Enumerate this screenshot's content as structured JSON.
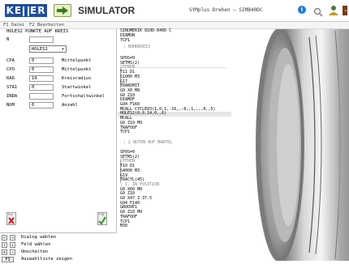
{
  "header": {
    "logo_text": "KELLER",
    "app_title": "SIMULATOR",
    "file_title": "SYMplus Drehen – SIMB40DC",
    "icons": [
      "run-icon",
      "info-icon",
      "search-icon",
      "user-icon",
      "exit-icon"
    ]
  },
  "menu": {
    "item1": "F1 Datei",
    "item2": "F2 Bearbeiten"
  },
  "dialog": {
    "title": "HOLES2 PUNKTE AUF KREIS",
    "n_label": "N",
    "n_value": "",
    "dropdown_value": "HOLES2",
    "fields": [
      {
        "label": "CPA",
        "value": "0",
        "desc": "Mittelpunkt"
      },
      {
        "label": "CPO",
        "value": "0",
        "desc": "Mittelpunkt"
      },
      {
        "label": "RAD",
        "value": "14",
        "desc": "Kreisradius"
      },
      {
        "label": "STA1",
        "value": "0",
        "desc": "Startwinkel"
      },
      {
        "label": "INDA",
        "value": "",
        "desc": "Fortschaltwinkel"
      },
      {
        "label": "NUM",
        "value": "6",
        "desc": "Anzahl"
      }
    ],
    "esc_label": "Esc",
    "f10_label": "F10"
  },
  "help": [
    {
      "k1": "←",
      "k2": "→",
      "text": "Dialog wählen"
    },
    {
      "k1": "↑",
      "k2": "↓",
      "text": "Feld wählen"
    },
    {
      "k1": "+",
      "k2": "−",
      "text": "Umschalten"
    },
    {
      "k1": "F3",
      "k2": "",
      "text": "Auswahlliste zeigen"
    }
  ],
  "code": {
    "header": "SINUMERIK 810D-840D C",
    "lines": [
      "DIAMON",
      "TCP1",
      "; BOHRKREIS",
      "SPOS=0",
      "SETMS(2)",
      "STFREN",
      "T11 D1",
      "S1000 M3",
      "G17",
      "TRANSMIT",
      "G0 X0 M8",
      "G0 Z10",
      "DIAMOF",
      "G94 F160",
      "MCALL CYCLE83(1,0,1,-16,,-8,,1,,,,0,,5)",
      "HOLES2(0,0,14,0,,6)",
      "MCALL",
      "G0 Z10 M9",
      "TRAFOOF",
      "TCP1",
      "; 2 NUTEN AUF MANTEL",
      "SPOS=0",
      "SETMS(2)",
      "STFREN",
      "T10 D1",
      "S4000 M3",
      "G19",
      "TRACYL(45)",
      "; 1. IN POSITION",
      "G0 X60 M8",
      "G0 Z10",
      "G0 X47 Z-37.5",
      "G94 F140",
      "GROOVE1",
      "G0 Z10 M9",
      "TRAFOOF",
      "TCP1",
      "M30"
    ]
  }
}
